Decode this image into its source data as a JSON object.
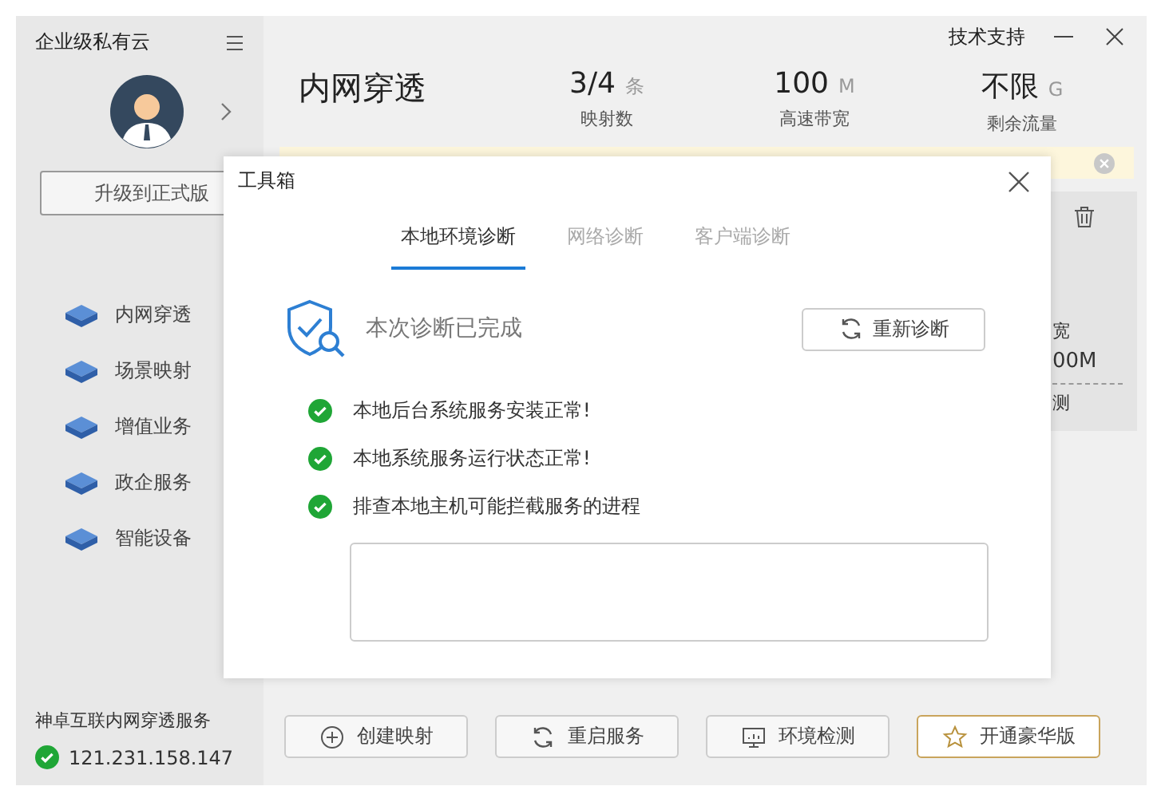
{
  "sidebar": {
    "title": "企业级私有云",
    "upgrade_button": "升级到正式版",
    "nav": [
      {
        "label": "内网穿透"
      },
      {
        "label": "场景映射"
      },
      {
        "label": "增值业务"
      },
      {
        "label": "政企服务"
      },
      {
        "label": "智能设备"
      }
    ],
    "service": {
      "name": "神卓互联内网穿透服务",
      "ip": "121.231.158.147",
      "online": true
    }
  },
  "titlebar": {
    "support": "技术支持"
  },
  "header": {
    "title": "内网穿透",
    "stats": [
      {
        "value": "3/4",
        "unit": "条",
        "label": "映射数"
      },
      {
        "value": "100",
        "unit": "M",
        "label": "高速带宽"
      },
      {
        "value": "不限",
        "unit": "G",
        "label": "剩余流量"
      }
    ]
  },
  "side_card": {
    "line_1": "宽",
    "line_2": "00M",
    "link": "测"
  },
  "toolbar": [
    {
      "label": "创建映射",
      "kind": "create"
    },
    {
      "label": "重启服务",
      "kind": "restart"
    },
    {
      "label": "环境检测",
      "kind": "monitor"
    },
    {
      "label": "开通豪华版",
      "kind": "premium"
    }
  ],
  "dialog": {
    "title": "工具箱",
    "tabs": [
      {
        "label": "本地环境诊断",
        "selected": true
      },
      {
        "label": "网络诊断",
        "selected": false
      },
      {
        "label": "客户端诊断",
        "selected": false
      }
    ],
    "status": "本次诊断已完成",
    "rerun_button": "重新诊断",
    "checks": [
      {
        "label": "本地后台系统服务安装正常!",
        "passed": true
      },
      {
        "label": "本地系统服务运行状态正常!",
        "passed": true
      },
      {
        "label": "排查本地主机可能拦截服务的进程",
        "passed": true
      }
    ]
  }
}
